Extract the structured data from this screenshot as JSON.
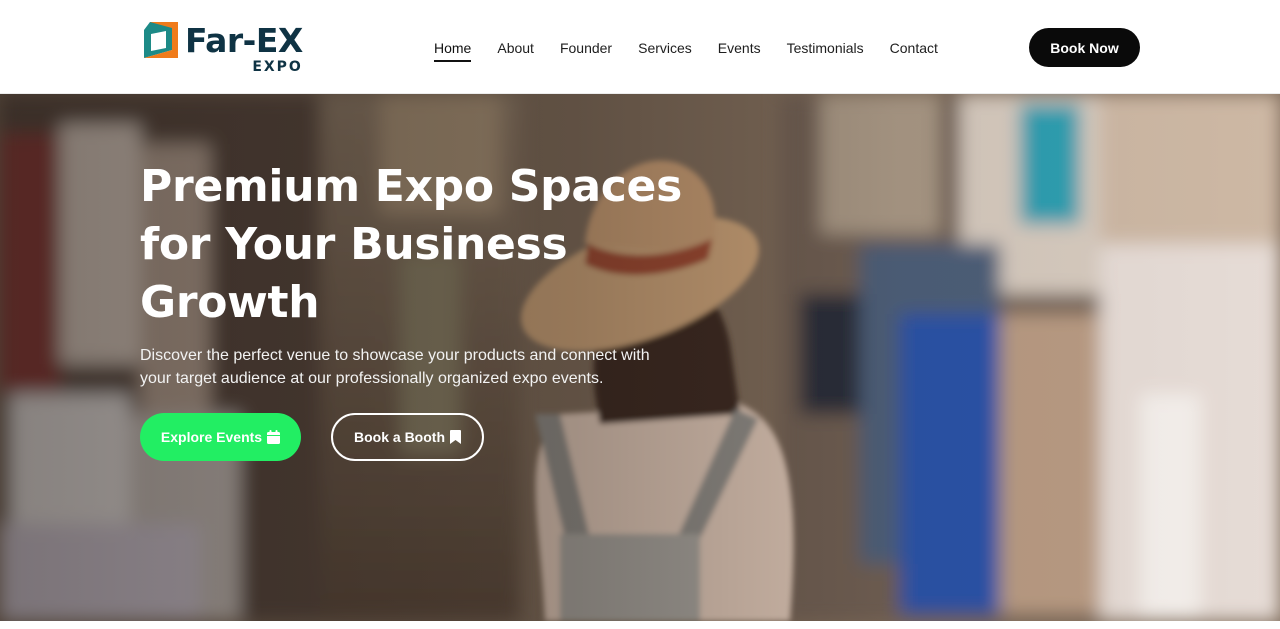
{
  "brand": {
    "name": "Far-EX",
    "sub": "EXPO"
  },
  "nav": [
    {
      "label": "Home",
      "active": true
    },
    {
      "label": "About"
    },
    {
      "label": "Founder"
    },
    {
      "label": "Services"
    },
    {
      "label": "Events"
    },
    {
      "label": "Testimonials"
    },
    {
      "label": "Contact"
    }
  ],
  "header": {
    "cta": "Book Now"
  },
  "hero": {
    "title": "Premium Expo Spaces for Your Business Growth",
    "description": "Discover the perfect venue to showcase your products and connect with your target audience at our professionally organized expo events.",
    "primary_cta": "Explore Events",
    "primary_cta_icon": "calendar-icon",
    "secondary_cta": "Book a Booth",
    "secondary_cta_icon": "bookmark-icon"
  },
  "colors": {
    "accent": "#22ee63",
    "brand_dark": "#0f3344",
    "logo_orange": "#f07b1a",
    "logo_teal": "#1d8a87"
  }
}
